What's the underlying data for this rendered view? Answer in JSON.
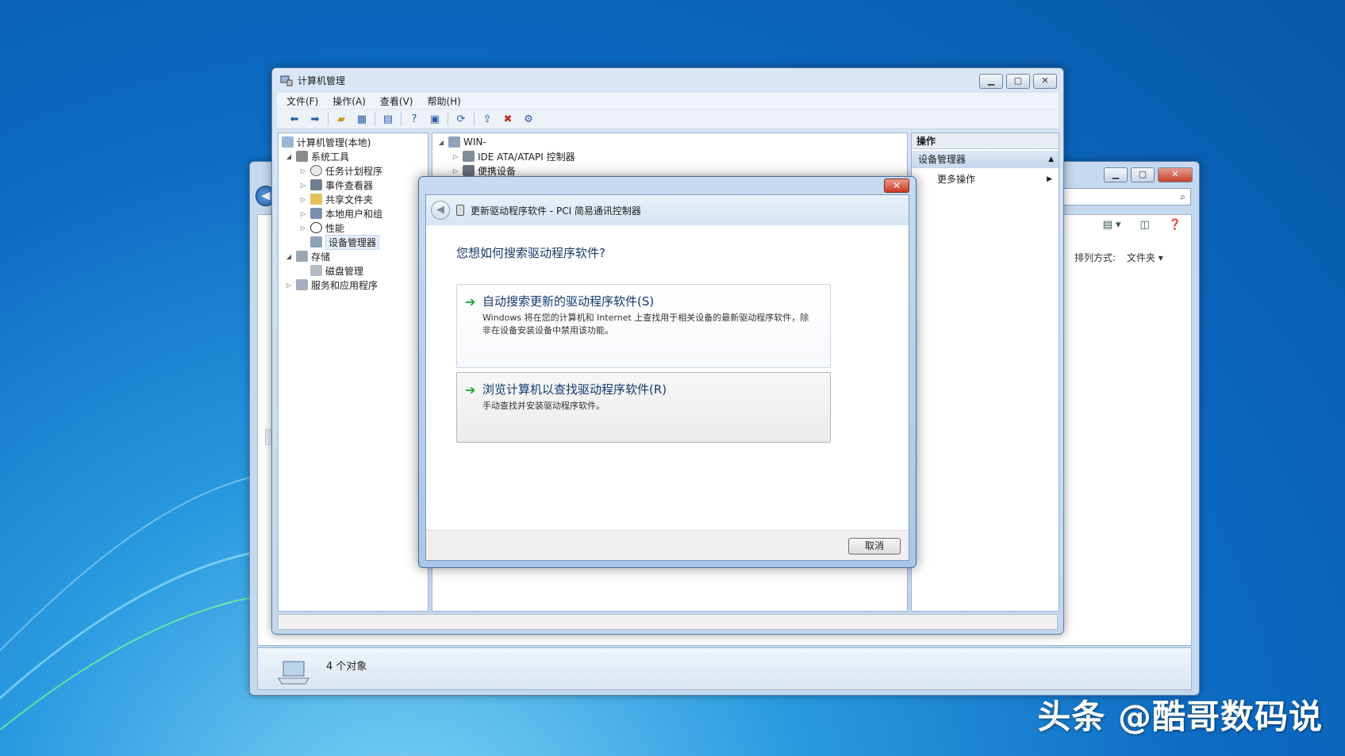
{
  "mmc": {
    "title": "计算机管理",
    "menus": [
      "文件(F)",
      "操作(A)",
      "查看(V)",
      "帮助(H)"
    ],
    "tree": {
      "root": "计算机管理(本地)",
      "system_tools": "系统工具",
      "task_scheduler": "任务计划程序",
      "event_viewer": "事件查看器",
      "shared_folders": "共享文件夹",
      "local_users": "本地用户和组",
      "performance": "性能",
      "device_manager": "设备管理器",
      "storage": "存储",
      "disk_management": "磁盘管理",
      "services_apps": "服务和应用程序"
    },
    "devices": {
      "computer": "WIN-",
      "ide": "IDE ATA/ATAPI 控制器",
      "other": "便携设备"
    },
    "actions": {
      "header": "操作",
      "section": "设备管理器",
      "more": "更多操作"
    }
  },
  "explorer": {
    "sort_label": "排列方式:",
    "sort_value": "文件夹",
    "status": "4 个对象"
  },
  "dialog": {
    "header": "更新驱动程序软件 - PCI 简易通讯控制器",
    "question": "您想如何搜索驱动程序软件?",
    "option1_title": "自动搜索更新的驱动程序软件(S)",
    "option1_desc": "Windows 将在您的计算机和 Internet 上查找用于相关设备的最新驱动程序软件，除非在设备安装设备中禁用该功能。",
    "option2_title": "浏览计算机以查找驱动程序软件(R)",
    "option2_desc": "手动查找并安装驱动程序软件。",
    "cancel": "取消"
  },
  "watermark": "头条 @酷哥数码说"
}
